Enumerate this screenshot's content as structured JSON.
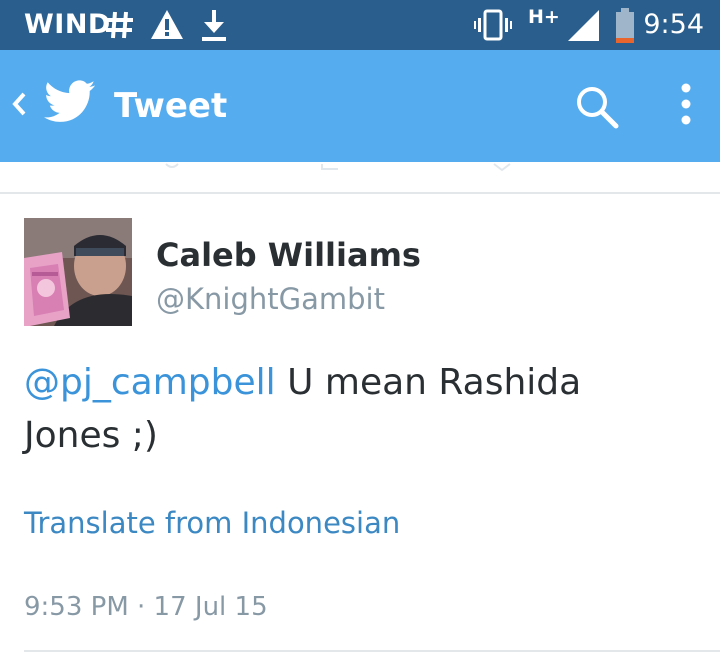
{
  "status_bar": {
    "carrier": "WIND",
    "icons": [
      "usb-debug-icon",
      "warning-icon",
      "download-icon",
      "vibrate-icon",
      "signal-icon",
      "battery-icon"
    ],
    "network_type": "H+",
    "time": "9:54",
    "battery_level": 0.15
  },
  "app_bar": {
    "title": "Tweet",
    "back_icon": "chevron-left-icon",
    "logo_icon": "twitter-bird-icon",
    "search_icon": "search-icon",
    "overflow_icon": "more-vert-icon",
    "color": "#55acee"
  },
  "tweet": {
    "author_name": "Caleb Williams",
    "author_handle": "@KnightGambit",
    "mention": "@pj_campbell",
    "text": " U mean Rashida Jones ;)",
    "translate_label": "Translate from Indonesian",
    "timestamp": "9:53 PM · 17 Jul 15"
  }
}
